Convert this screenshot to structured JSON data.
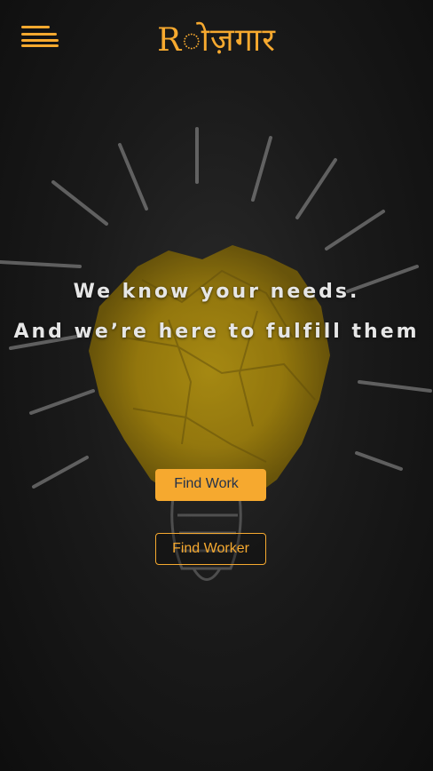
{
  "header": {
    "brand": "Rोज़गार",
    "menu_icon": "hamburger-menu-icon"
  },
  "hero": {
    "image": "crumpled-paper-lightbulb",
    "headline_line1": "We know your needs.",
    "headline_line2": "And we’re here to fulfill them"
  },
  "actions": {
    "find_work": "Find Work",
    "find_worker": "Find Worker"
  },
  "colors": {
    "accent": "#f6a92f",
    "primary_button_text": "#24324a",
    "headline_text": "#e6e6e6",
    "background": "#121212"
  }
}
